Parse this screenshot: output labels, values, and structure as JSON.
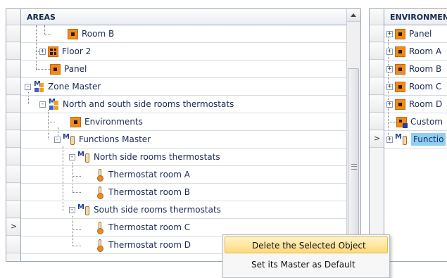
{
  "left": {
    "header": "AREAS",
    "rows": [
      {
        "label": "Room B",
        "icon": "room-icon"
      },
      {
        "label": "Floor 2",
        "icon": "floor-icon",
        "expander": "+"
      },
      {
        "label": "Panel",
        "icon": "room-icon"
      },
      {
        "label": "Zone Master",
        "icon": "zone-master-icon",
        "expander": "-"
      },
      {
        "label": "North and south side rooms thermostats",
        "icon": "zone-master-icon",
        "expander": "-"
      },
      {
        "label": "Environments",
        "icon": "room-icon"
      },
      {
        "label": "Functions Master",
        "icon": "functions-master-icon",
        "expander": "-"
      },
      {
        "label": "North side rooms thermostats",
        "icon": "functions-master-icon",
        "expander": "-"
      },
      {
        "label": "Thermostat room A",
        "icon": "thermostat-icon"
      },
      {
        "label": "Thermostat room B",
        "icon": "thermostat-icon"
      },
      {
        "label": "South side rooms thermostats",
        "icon": "functions-master-icon",
        "expander": "-"
      },
      {
        "label": "Thermostat room C",
        "icon": "thermostat-icon",
        "highlight": "#ffff00"
      },
      {
        "label": "Thermostat room D",
        "icon": "thermostat-icon"
      }
    ]
  },
  "right": {
    "header": "ENVIRONMENT",
    "rows": [
      {
        "label": "Panel",
        "icon": "room-icon",
        "expander": "+"
      },
      {
        "label": "Room A",
        "icon": "room-icon",
        "expander": "+"
      },
      {
        "label": "Room B",
        "icon": "room-icon",
        "expander": "+"
      },
      {
        "label": "Room C",
        "icon": "room-icon",
        "expander": "+"
      },
      {
        "label": "Room D",
        "icon": "room-icon",
        "expander": "+"
      },
      {
        "label": "Custom",
        "icon": "custom-icon"
      },
      {
        "label": "Functio",
        "icon": "functions-master-icon",
        "expander": "+",
        "highlight": "#8fcff5"
      }
    ]
  },
  "context_menu": {
    "items": [
      {
        "label": "Delete the Selected Object",
        "selected": true
      },
      {
        "label": "Set its Master as Default",
        "selected": false
      }
    ]
  },
  "colors": {
    "selection_highlight": "#ffff00",
    "menu_hover": "#ffd97a",
    "right_selection": "#8fcff5"
  }
}
